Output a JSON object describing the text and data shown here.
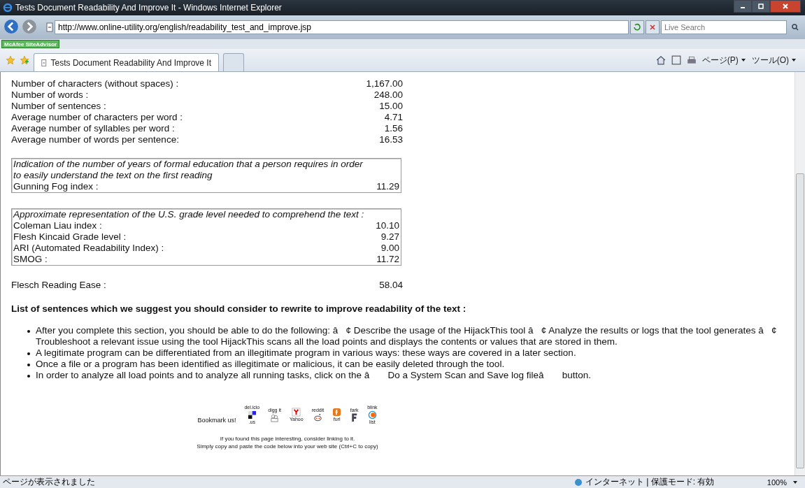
{
  "window": {
    "title": "Tests Document Readability And Improve It - Windows Internet Explorer"
  },
  "address_bar": {
    "url": "http://www.online-utility.org/english/readability_test_and_improve.jsp",
    "search_placeholder": "Live Search"
  },
  "addon_bar": {
    "label": "McAfee SiteAdvisor"
  },
  "tab": {
    "label": "Tests Document Readability And Improve It",
    "selected": true
  },
  "command_bar": {
    "page_menu": "ページ(P)",
    "tools_menu": "ツール(O)"
  },
  "stats": [
    {
      "label": "Number of characters (without spaces) :",
      "value": "1,167.00"
    },
    {
      "label": "Number of words :",
      "value": "248.00"
    },
    {
      "label": "Number of sentences :",
      "value": "15.00"
    },
    {
      "label": "Average number of characters per word :",
      "value": "4.71"
    },
    {
      "label": "Average number of syllables per word :",
      "value": "1.56"
    },
    {
      "label": "Average number of words per sentence:",
      "value": "16.53"
    }
  ],
  "groups": [
    {
      "description": "Indication of the number of years of formal education that a person requires in order to easily understand the text on the first reading",
      "rows": [
        {
          "label": "Gunning Fog index :",
          "value": "11.29"
        }
      ]
    },
    {
      "description": "Approximate representation of the U.S. grade level needed to comprehend the text :",
      "rows": [
        {
          "label": "Coleman Liau index :",
          "value": "10.10"
        },
        {
          "label": "Flesh Kincaid Grade level :",
          "value": "9.27"
        },
        {
          "label": "ARI (Automated Readability Index) :",
          "value": "9.00"
        },
        {
          "label": "SMOG :",
          "value": "11.72"
        }
      ]
    }
  ],
  "reading_ease": {
    "label": "Flesch Reading Ease :",
    "value": "58.04"
  },
  "suggestions_heading": "List of sentences which we suggest you should consider to rewrite to improve readability of the text :",
  "suggestions": [
    "After you complete this section, you should be able to do the following: â   ¢ Describe the usage of the HijackThis tool â   ¢ Analyze the results or logs that the tool generates â   ¢ Troubleshoot a relevant issue using the tool HijackThis scans all the load points and displays the contents or values that are stored in them.",
    "A legitimate program can be differentiated from an illegitimate program in various ways: these ways are covered in a later section.",
    "Once a file or a program has been identified as illegitimate or malicious, it can be easily deleted through the tool.",
    "In order to analyze all load points and to analyze all running tasks, click on the â       Do a System Scan and Save log fileâ       button."
  ],
  "bookmark": {
    "label": "Bookmark us!",
    "sites": [
      {
        "kind": "delicious",
        "top": "del.icio",
        "bottom": ".us"
      },
      {
        "kind": "digg",
        "top": "digg it"
      },
      {
        "kind": "yahoo",
        "bottom": "Yahoo"
      },
      {
        "kind": "reddit",
        "top": "reddit"
      },
      {
        "kind": "furl",
        "bottom": "furl"
      },
      {
        "kind": "fark",
        "top": "fark"
      },
      {
        "kind": "blink",
        "top": "blink",
        "bottom": "list"
      }
    ]
  },
  "linking": [
    "If you found this page interesting, consider linking to it.",
    "Simply copy and paste the code below into your web site (Ctrl+C to copy)"
  ],
  "status_bar": {
    "message": "ページが表示されました",
    "zone": "インターネット | 保護モード: 有効",
    "zoom": "100%"
  }
}
